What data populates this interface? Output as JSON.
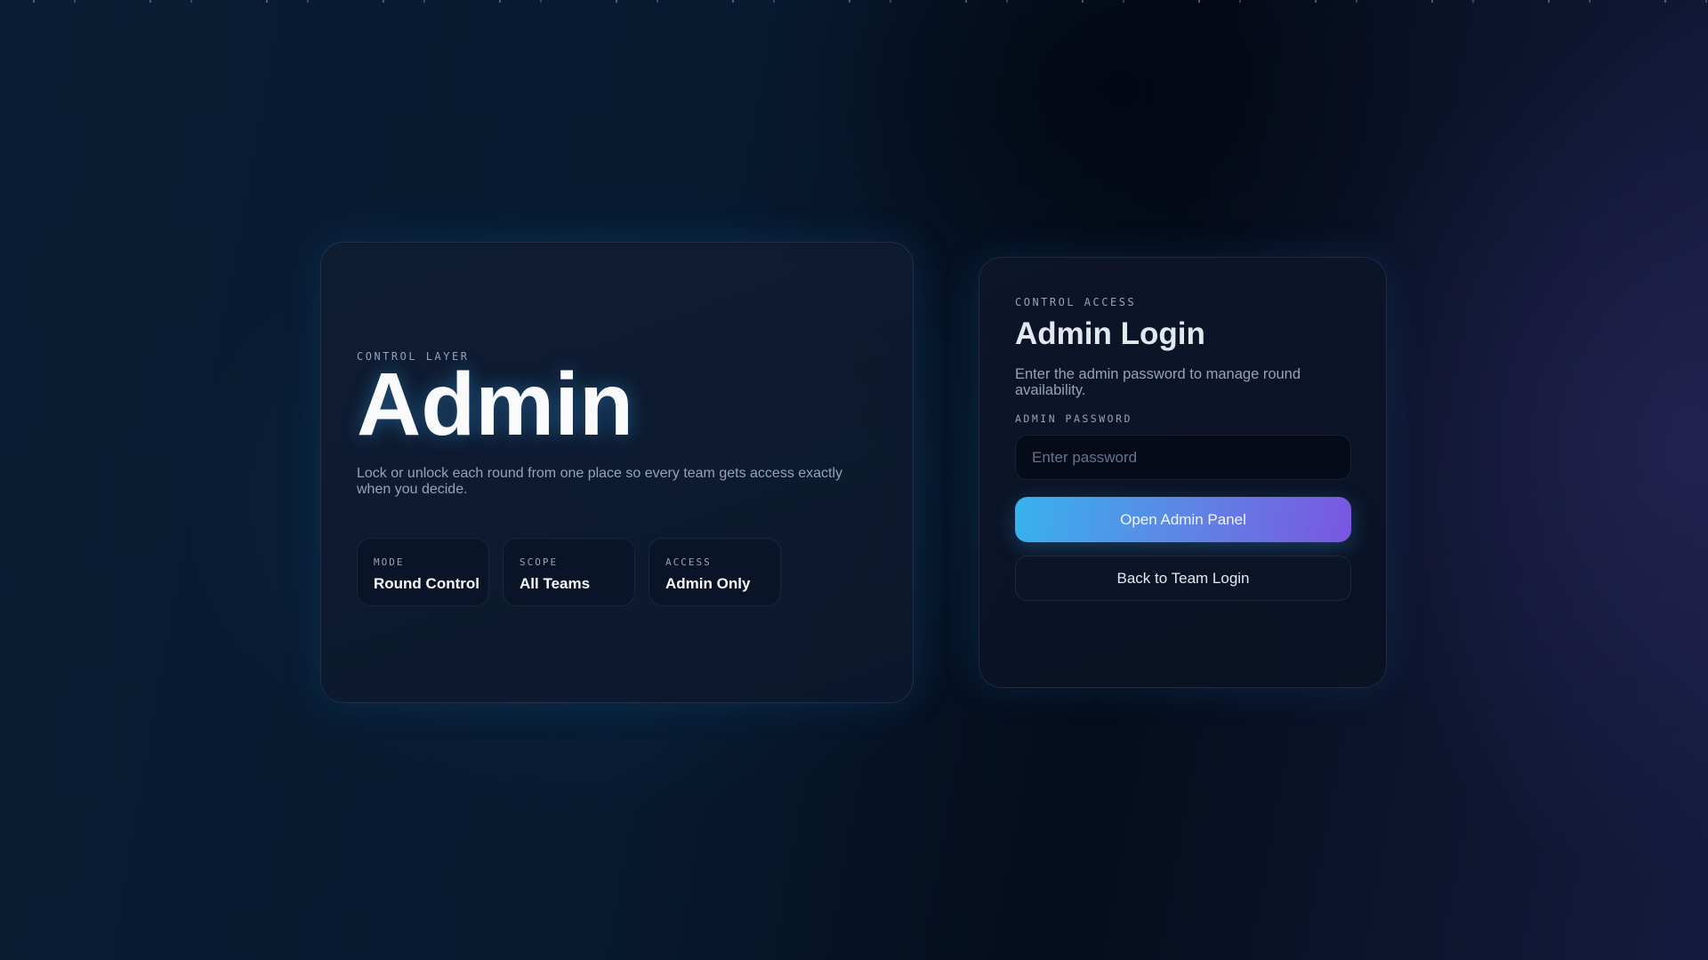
{
  "hero": {
    "eyebrow": "CONTROL LAYER",
    "title": "Admin",
    "description": "Lock or unlock each round from one place so every team gets access exactly when you decide.",
    "stats": [
      {
        "label": "MODE",
        "value": "Round Control"
      },
      {
        "label": "SCOPE",
        "value": "All Teams"
      },
      {
        "label": "ACCESS",
        "value": "Admin Only"
      }
    ]
  },
  "login": {
    "eyebrow": "CONTROL ACCESS",
    "title": "Admin Login",
    "description": "Enter the admin password to manage round availability.",
    "password_label": "ADMIN PASSWORD",
    "password_value": "",
    "password_placeholder": "Enter password",
    "submit_label": "Open Admin Panel",
    "back_label": "Back to Team Login"
  },
  "colors": {
    "accent_start": "#38b2ec",
    "accent_end": "#7a56e0",
    "background": "#071a30"
  }
}
